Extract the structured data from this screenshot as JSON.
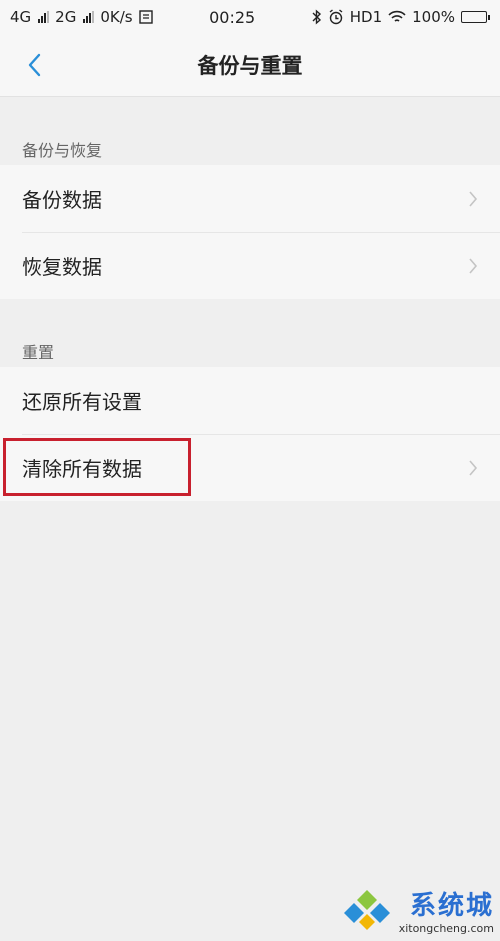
{
  "status_bar": {
    "net1": "4G",
    "net2": "2G",
    "speed": "0K/s",
    "time": "00:25",
    "hd": "HD1",
    "battery": "100%"
  },
  "header": {
    "title": "备份与重置"
  },
  "sections": [
    {
      "label": "备份与恢复",
      "items": [
        {
          "label": "备份数据"
        },
        {
          "label": "恢复数据"
        }
      ]
    },
    {
      "label": "重置",
      "items": [
        {
          "label": "还原所有设置"
        },
        {
          "label": "清除所有数据"
        }
      ]
    }
  ],
  "watermark": {
    "name": "系统城",
    "url": "xitongcheng.com"
  },
  "colors": {
    "accent": "#2a8fd8",
    "highlight": "#c8202e"
  }
}
